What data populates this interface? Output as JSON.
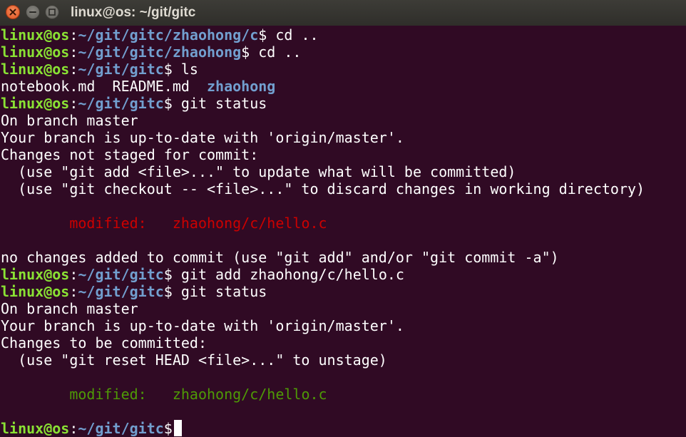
{
  "window": {
    "title": "linux@os: ~/git/gitc"
  },
  "terminal": {
    "prompt_user": "linux@os",
    "prompt_sep": ":",
    "lines": [
      {
        "path": "~/git/gitc/zhaohong/c",
        "cmd": " cd .."
      },
      {
        "path": "~/git/gitc/zhaohong",
        "cmd": " cd .."
      },
      {
        "path": "~/git/gitc",
        "cmd": " ls"
      },
      {
        "ls_files": "notebook.md  README.md  ",
        "ls_dir": "zhaohong"
      },
      {
        "path": "~/git/gitc",
        "cmd": " git status"
      },
      {
        "text": "On branch master"
      },
      {
        "text": "Your branch is up-to-date with 'origin/master'."
      },
      {
        "text": "Changes not staged for commit:"
      },
      {
        "text": "  (use \"git add <file>...\" to update what will be committed)"
      },
      {
        "text": "  (use \"git checkout -- <file>...\" to discard changes in working directory)"
      },
      {
        "text": ""
      },
      {
        "modified_label": "        modified:   ",
        "modified_file": "zhaohong/c/hello.c",
        "color": "red"
      },
      {
        "text": ""
      },
      {
        "text": "no changes added to commit (use \"git add\" and/or \"git commit -a\")"
      },
      {
        "path": "~/git/gitc",
        "cmd": " git add zhaohong/c/hello.c"
      },
      {
        "path": "~/git/gitc",
        "cmd": " git status"
      },
      {
        "text": "On branch master"
      },
      {
        "text": "Your branch is up-to-date with 'origin/master'."
      },
      {
        "text": "Changes to be committed:"
      },
      {
        "text": "  (use \"git reset HEAD <file>...\" to unstage)"
      },
      {
        "text": ""
      },
      {
        "modified_label": "        modified:   ",
        "modified_file": "zhaohong/c/hello.c",
        "color": "green"
      },
      {
        "text": ""
      },
      {
        "path": "~/git/gitc",
        "cmd": " ",
        "cursor": true
      }
    ]
  },
  "colors": {
    "background": "#300a24",
    "prompt_user": "#8ae234",
    "prompt_path": "#729fcf",
    "unstaged": "#cc0000",
    "staged": "#4e9a06",
    "text": "#ffffff"
  }
}
